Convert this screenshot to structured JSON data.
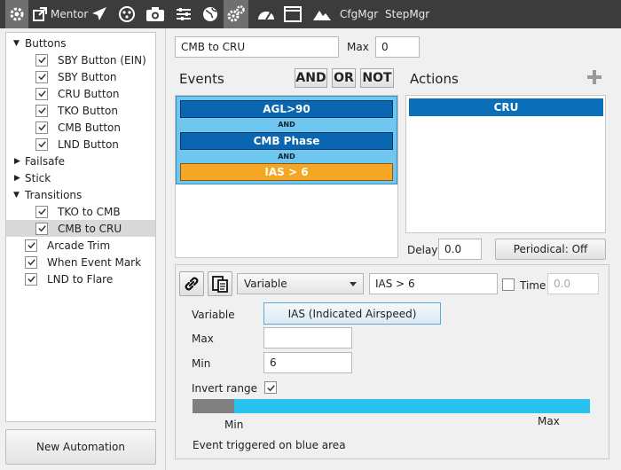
{
  "toolbar": {
    "mentor_label": "Mentor",
    "cfgmgr_label": "CfgMgr",
    "stepmgr_label": "StepMgr",
    "icons": [
      "settings-gear-icon",
      "external-link-icon",
      "airplane-icon",
      "dots-circle-icon",
      "camera-icon",
      "sliders-icon",
      "globe-icon",
      "gears-icon",
      "gauge-icon",
      "window-icon",
      "mountains-icon"
    ]
  },
  "tree": {
    "buttons": "Buttons",
    "sby_button_ein": "SBY Button (EIN)",
    "sby_button": "SBY Button",
    "cru_button": "CRU Button",
    "tko_button": "TKO Button",
    "cmb_button": "CMB Button",
    "lnd_button": "LND Button",
    "failsafe": "Failsafe",
    "stick": "Stick",
    "transitions": "Transitions",
    "tko_to_cmb": "TKO to CMB",
    "cmb_to_cru": "CMB to CRU",
    "arcade_trim": "Arcade Trim",
    "when_event_mark": "When Event Mark",
    "lnd_to_flare": "LND to Flare"
  },
  "new_automation_label": "New Automation",
  "automation": {
    "name_value": "CMB to CRU",
    "max_label": "Max",
    "max_value": "0"
  },
  "events": {
    "heading": "Events",
    "and_btn": "AND",
    "or_btn": "OR",
    "not_btn": "NOT",
    "items": [
      "AGL>90",
      "CMB Phase",
      "IAS > 6"
    ],
    "connector": "AND"
  },
  "actions": {
    "heading": "Actions",
    "items": [
      "CRU"
    ],
    "delay_label": "Delay",
    "delay_value": "0.0",
    "periodical_label": "Periodical: Off"
  },
  "event_editor": {
    "type_selected": "Variable",
    "event_name": "IAS > 6",
    "time_label": "Time",
    "time_value": "0.0",
    "variable_label": "Variable",
    "variable_value": "IAS (Indicated Airspeed)",
    "max_label": "Max",
    "max_value": "",
    "min_label": "Min",
    "min_value": "6",
    "invert_label": "Invert range",
    "range_min_label": "Min",
    "range_max_label": "Max",
    "footer_text": "Event triggered on blue area"
  },
  "colors": {
    "event_blue": "#0a66b0",
    "event_orange": "#f5a623",
    "events_bg": "#6fc6ee",
    "range_blue": "#29c2f0",
    "range_gray": "#808080"
  }
}
